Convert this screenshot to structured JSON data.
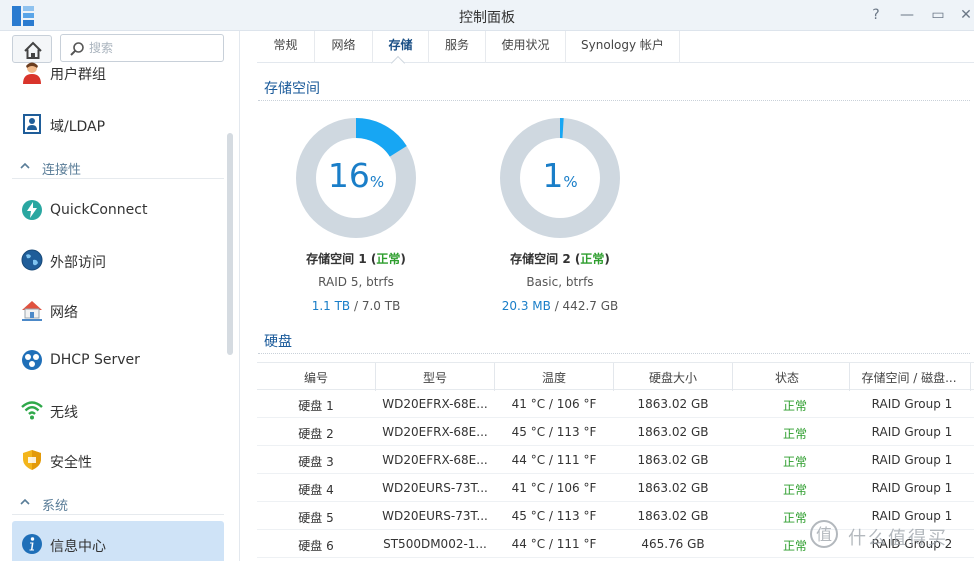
{
  "window": {
    "title": "控制面板"
  },
  "titlebar": {
    "help_glyph": "?",
    "minimize_glyph": "—",
    "maximize_glyph": "▭",
    "close_glyph": "✕"
  },
  "sidebar": {
    "search_placeholder": "搜索",
    "items": [
      {
        "label": "用户群组"
      },
      {
        "label": "域/LDAP"
      },
      {
        "label": "QuickConnect"
      },
      {
        "label": "外部访问"
      },
      {
        "label": "网络"
      },
      {
        "label": "DHCP Server"
      },
      {
        "label": "无线"
      },
      {
        "label": "安全性"
      },
      {
        "label": "信息中心"
      }
    ],
    "sections": [
      {
        "label": "连接性"
      },
      {
        "label": "系统"
      }
    ]
  },
  "tabs": [
    {
      "label": "常规"
    },
    {
      "label": "网络"
    },
    {
      "label": "存储",
      "active": true
    },
    {
      "label": "服务"
    },
    {
      "label": "使用状况"
    },
    {
      "label": "Synology 帐户"
    }
  ],
  "storage": {
    "title": "存储空间",
    "volumes": [
      {
        "percent": "16",
        "percent_value": 16,
        "percent_sign": "%",
        "name": "存储空间 1",
        "status": "正常",
        "raid": "RAID 5, btrfs",
        "used": "1.1 TB",
        "total": "/ 7.0 TB"
      },
      {
        "percent": "1",
        "percent_value": 1,
        "percent_sign": "%",
        "name": "存储空间 2",
        "status": "正常",
        "raid": "Basic, btrfs",
        "used": "20.3 MB",
        "total": "/ 442.7 GB"
      }
    ]
  },
  "disks": {
    "title": "硬盘",
    "columns": [
      "编号",
      "型号",
      "温度",
      "硬盘大小",
      "状态",
      "存储空间 / 磁盘..."
    ],
    "rows": [
      [
        "硬盘 1",
        "WD20EFRX-68E...",
        "41 °C / 106 °F",
        "1863.02 GB",
        "正常",
        "RAID Group 1"
      ],
      [
        "硬盘 2",
        "WD20EFRX-68E...",
        "45 °C / 113 °F",
        "1863.02 GB",
        "正常",
        "RAID Group 1"
      ],
      [
        "硬盘 3",
        "WD20EFRX-68E...",
        "44 °C / 111 °F",
        "1863.02 GB",
        "正常",
        "RAID Group 1"
      ],
      [
        "硬盘 4",
        "WD20EURS-73T...",
        "41 °C / 106 °F",
        "1863.02 GB",
        "正常",
        "RAID Group 1"
      ],
      [
        "硬盘 5",
        "WD20EURS-73T...",
        "45 °C / 113 °F",
        "1863.02 GB",
        "正常",
        "RAID Group 1"
      ],
      [
        "硬盘 6",
        "ST500DM002-1...",
        "44 °C / 111 °F",
        "465.76 GB",
        "正常",
        "RAID Group 2"
      ]
    ]
  },
  "watermark": {
    "text": "什么值得买"
  },
  "colors": {
    "accent": "#1a7ec8",
    "ring_track": "#cfd8e0",
    "ring_fill": "#17a6f3",
    "ok": "#2e9e2e",
    "active_bg": "#cfe3f7"
  },
  "icons": {
    "sidebar": [
      "users-icon",
      "ldap-icon",
      "quickconnect-icon",
      "globe-icon",
      "network-home-icon",
      "dhcp-icon",
      "wifi-icon",
      "shield-icon",
      "info-icon"
    ]
  }
}
